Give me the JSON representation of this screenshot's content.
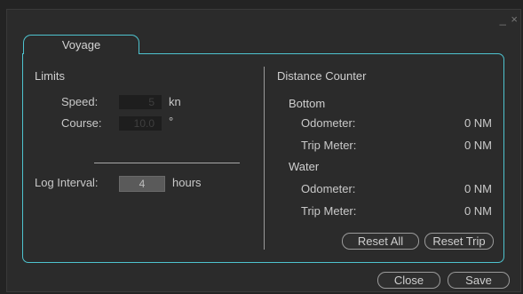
{
  "window": {
    "controls": "_ ×"
  },
  "tab": {
    "label": "Voyage"
  },
  "limits": {
    "heading": "Limits",
    "speed_label": "Speed:",
    "speed_value": "5",
    "speed_unit": "kn",
    "course_label": "Course:",
    "course_value": "10.0",
    "course_unit": "°",
    "log_interval_label": "Log Interval:",
    "log_interval_value": "4",
    "log_interval_unit": "hours"
  },
  "distance": {
    "heading": "Distance Counter",
    "bottom": {
      "heading": "Bottom",
      "odometer_label": "Odometer:",
      "odometer_value": "0 NM",
      "trip_label": "Trip Meter:",
      "trip_value": "0 NM"
    },
    "water": {
      "heading": "Water",
      "odometer_label": "Odometer:",
      "odometer_value": "0 NM",
      "trip_label": "Trip Meter:",
      "trip_value": "0 NM"
    },
    "reset_all_label": "Reset All",
    "reset_trip_label": "Reset Trip"
  },
  "footer": {
    "close_label": "Close",
    "save_label": "Save"
  }
}
